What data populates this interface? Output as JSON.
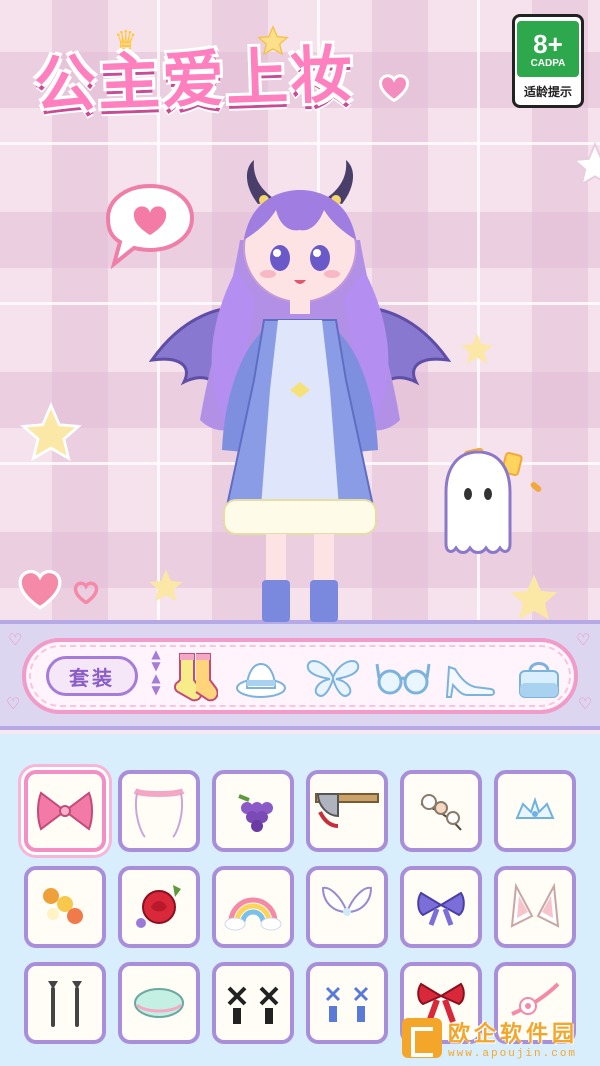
{
  "game": {
    "title": "公主爱上妆",
    "rating": {
      "age": "8+",
      "org": "CADPA",
      "label": "适龄提示"
    }
  },
  "categories": {
    "suit_label": "套装",
    "tabs": [
      {
        "name": "socks",
        "icon": "socks-icon"
      },
      {
        "name": "hat",
        "icon": "hat-icon"
      },
      {
        "name": "wings",
        "icon": "butterfly-icon"
      },
      {
        "name": "glasses",
        "icon": "glasses-icon"
      },
      {
        "name": "shoes",
        "icon": "high-heel-icon"
      },
      {
        "name": "bag",
        "icon": "handbag-icon"
      }
    ]
  },
  "items": [
    {
      "icon": "pink-bow-icon",
      "selected": true
    },
    {
      "icon": "flower-veil-icon"
    },
    {
      "icon": "grapes-icon"
    },
    {
      "icon": "axe-headband-icon"
    },
    {
      "icon": "flower-sprig-icon"
    },
    {
      "icon": "tiara-icon"
    },
    {
      "icon": "flower-clip-icon"
    },
    {
      "icon": "rose-icon"
    },
    {
      "icon": "rainbow-icon"
    },
    {
      "icon": "fairy-wings-icon"
    },
    {
      "icon": "blue-bow-icon"
    },
    {
      "icon": "animal-ears-icon"
    },
    {
      "icon": "hair-pins-icon"
    },
    {
      "icon": "mint-cap-icon"
    },
    {
      "icon": "ribbon-clips-icon"
    },
    {
      "icon": "blue-clips-icon"
    },
    {
      "icon": "red-bow-icon"
    },
    {
      "icon": "flower-headband-icon"
    }
  ],
  "watermark": {
    "title": "欧企软件园",
    "url": "www.apoujin.com"
  },
  "colors": {
    "accent_pink": "#f19bc8",
    "accent_purple": "#a98ed9",
    "panel_blue": "#d9eefc"
  }
}
